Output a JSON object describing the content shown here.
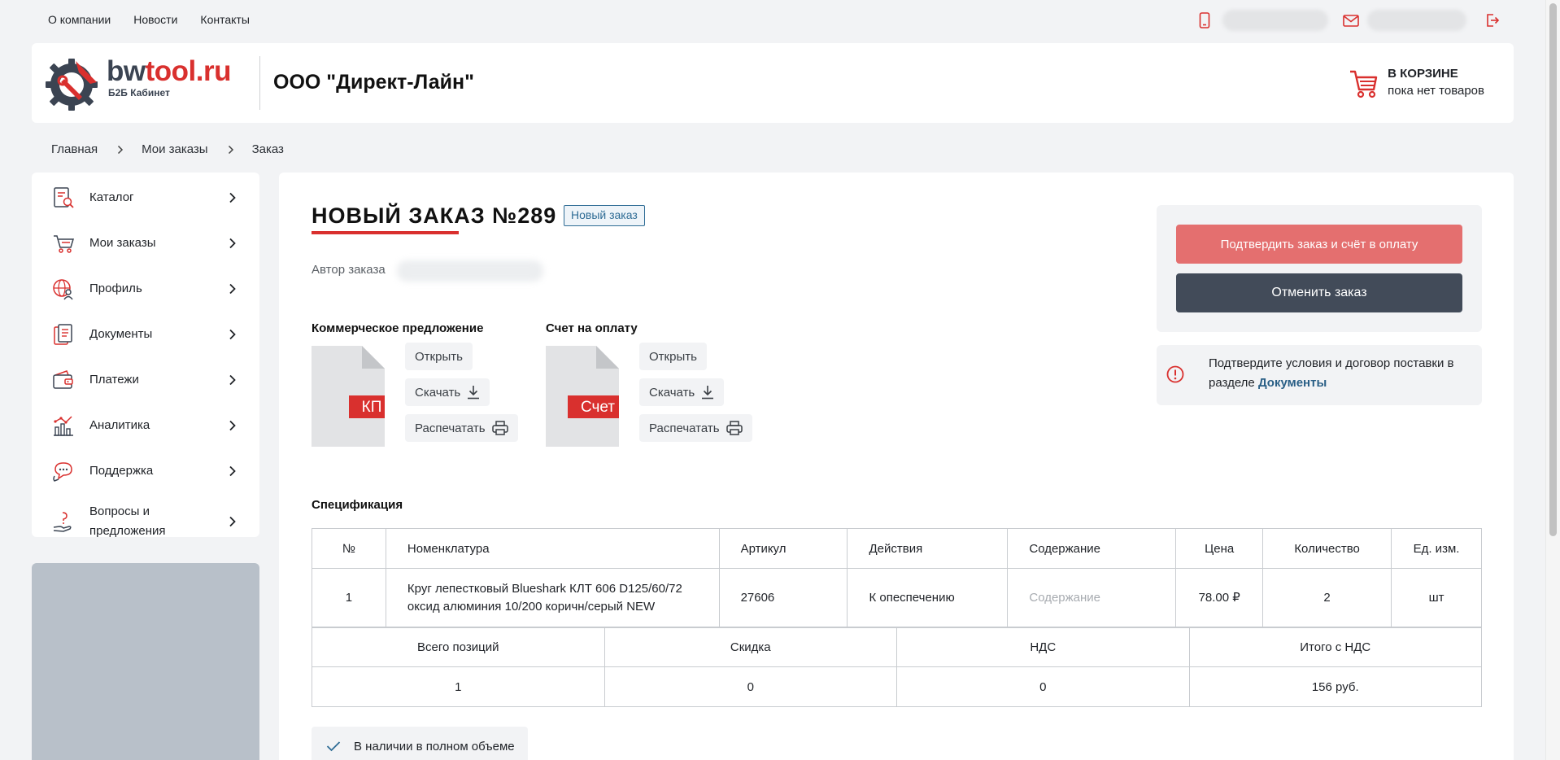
{
  "topnav": {
    "links": [
      "О компании",
      "Новости",
      "Контакты"
    ]
  },
  "header": {
    "logo_name_bw": "bw",
    "logo_name_rest": "tool.ru",
    "logo_sub": "Б2Б Кабинет",
    "company": "ООО \"Директ-Лайн\"",
    "cart_title": "В КОРЗИНЕ",
    "cart_sub": "пока нет товаров"
  },
  "breadcrumb": [
    "Главная",
    "Мои заказы",
    "Заказ"
  ],
  "sidebar": {
    "items": [
      {
        "label": "Каталог",
        "icon": "catalog-icon"
      },
      {
        "label": "Мои заказы",
        "icon": "orders-cart-icon"
      },
      {
        "label": "Профиль",
        "icon": "profile-globe-icon"
      },
      {
        "label": "Документы",
        "icon": "documents-icon"
      },
      {
        "label": "Платежи",
        "icon": "wallet-icon"
      },
      {
        "label": "Аналитика",
        "icon": "analytics-icon"
      },
      {
        "label": "Поддержка",
        "icon": "support-chat-icon"
      },
      {
        "label": "Вопросы и предложения",
        "icon": "question-hand-icon"
      }
    ]
  },
  "order": {
    "title": "НОВЫЙ ЗАКАЗ №289",
    "status": "Новый заказ",
    "author_label": "Автор заказа"
  },
  "documents": [
    {
      "title": "Коммерческое предложение",
      "tag": "КП",
      "open": "Открыть",
      "download": "Скачать",
      "print": "Распечатать"
    },
    {
      "title": "Счет на оплату",
      "tag": "Счет",
      "open": "Открыть",
      "download": "Скачать",
      "print": "Распечатать"
    }
  ],
  "actions": {
    "confirm": "Подтвердить заказ и счёт в оплату",
    "cancel": "Отменить заказ"
  },
  "notice": {
    "text": "Подтвердите условия и договор поставки в разделе",
    "link": "Документы"
  },
  "spec": {
    "title": "Спецификация",
    "columns": [
      "№",
      "Номенклатура",
      "Артикул",
      "Действия",
      "Содержание",
      "Цена",
      "Количество",
      "Ед. изм."
    ],
    "rows": [
      {
        "num": "1",
        "name": "Круг лепестковый Blueshark КЛТ 606 D125/60/72 оксид алюминия 10/200 коричн/серый NEW",
        "article": "27606",
        "action": "К опеспечению",
        "content": "Содержание",
        "price": "78.00 ₽",
        "qty": "2",
        "unit": "шт"
      }
    ],
    "summary_labels": [
      "Всего позиций",
      "Скидка",
      "НДС",
      "Итого с НДС"
    ],
    "summary_values": [
      "1",
      "0",
      "0",
      "156 руб."
    ]
  },
  "stock": {
    "label": "В наличии в полном объеме"
  },
  "colors": {
    "accent": "#d9302e",
    "dark": "#424b59",
    "link": "#2a5f86"
  }
}
